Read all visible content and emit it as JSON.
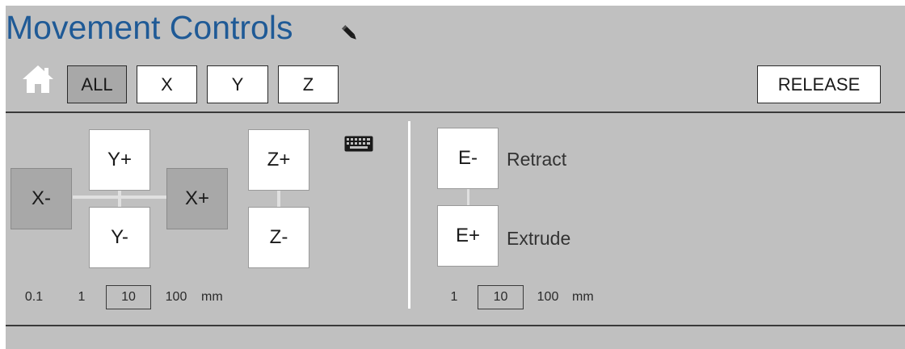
{
  "header": {
    "title": "Movement Controls",
    "icons": {
      "edit": "pencil-icon",
      "home": "home-icon",
      "keyboard": "keyboard-icon"
    }
  },
  "axis_buttons": [
    {
      "label": "ALL",
      "selected": true
    },
    {
      "label": "X",
      "selected": false
    },
    {
      "label": "Y",
      "selected": false
    },
    {
      "label": "Z",
      "selected": false
    }
  ],
  "release_label": "RELEASE",
  "jog": {
    "x_minus": "X-",
    "x_plus": "X+",
    "y_plus": "Y+",
    "y_minus": "Y-",
    "z_plus": "Z+",
    "z_minus": "Z-"
  },
  "xyz_steps": {
    "options": [
      "0.1",
      "1",
      "10",
      "100"
    ],
    "selected": "10",
    "unit": "mm"
  },
  "extruder": {
    "retract_button": "E-",
    "retract_label": "Retract",
    "extrude_button": "E+",
    "extrude_label": "Extrude",
    "steps": {
      "options": [
        "1",
        "10",
        "100"
      ],
      "selected": "10",
      "unit": "mm"
    }
  },
  "colors": {
    "title": "#1f5a96",
    "panel": "#c0c0c0",
    "selected_button": "#a8a8a8"
  }
}
